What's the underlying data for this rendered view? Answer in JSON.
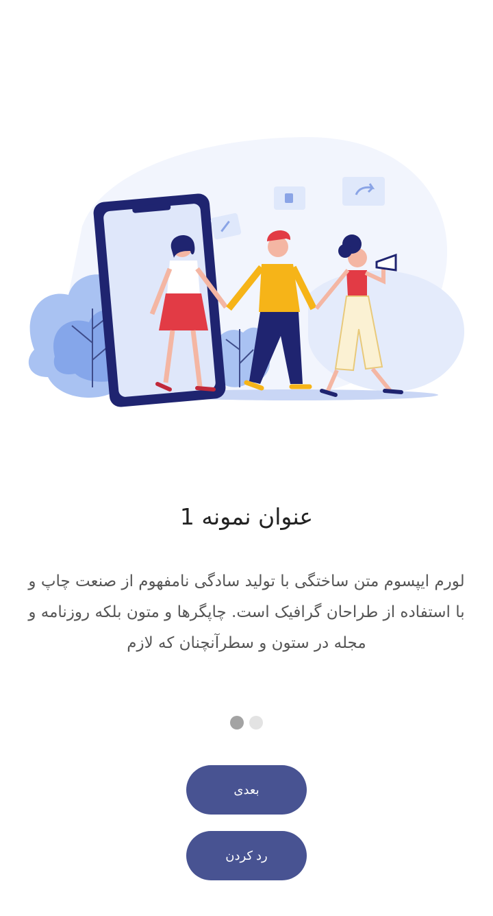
{
  "onboarding": {
    "title": "عنوان نمونه 1",
    "description": "لورم ایپسوم متن ساختگی با تولید سادگی نامفهوم از صنعت چاپ و با استفاده از طراحان گرافیک است. چاپگرها و متون بلکه روزنامه و مجله در ستون و سطرآنچنان که لازم",
    "page_indicator": {
      "current": 1,
      "total": 2
    }
  },
  "buttons": {
    "next_label": "بعدی",
    "reject_label": "رد کردن"
  },
  "colors": {
    "primary": "#485392",
    "dot_active": "#a3a3a3",
    "dot_inactive": "#e3e3e3"
  }
}
